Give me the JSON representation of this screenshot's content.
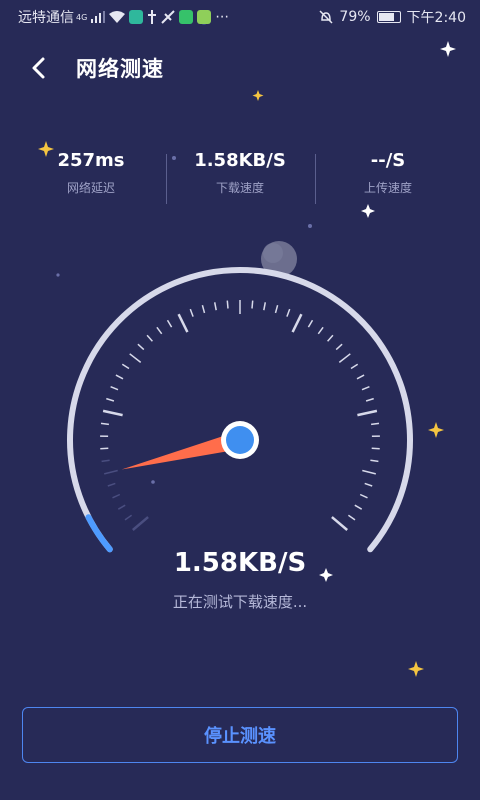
{
  "status_bar": {
    "carrier": "远特通信",
    "network": "4G",
    "time": "下午2:40",
    "battery_percent": "79%",
    "battery_level": 0.79,
    "icons": [
      "signal-icon",
      "wifi-icon",
      "app-notification-icon",
      "usb-icon",
      "airplane-icon",
      "app-icon",
      "app-icon",
      "more-icon",
      "mute-icon",
      "battery-icon"
    ]
  },
  "header": {
    "title": "网络测速",
    "back_icon": "chevron-left-icon"
  },
  "stats": [
    {
      "value": "257ms",
      "label": "网络延迟"
    },
    {
      "value": "1.58KB/S",
      "label": "下载速度"
    },
    {
      "value": "--/S",
      "label": "上传速度"
    }
  ],
  "gauge": {
    "progress": 0.05,
    "needle_fraction": 0.1,
    "accent": "#4e9bff",
    "needle_color": "#ff6d4b"
  },
  "speed_readout": "1.58KB/S",
  "status_text": "正在测试下载速度...",
  "stop_button": "停止测速",
  "colors": {
    "background": "#272a57",
    "accent": "#4e86f0",
    "gauge_track": "#d7d9ea"
  }
}
